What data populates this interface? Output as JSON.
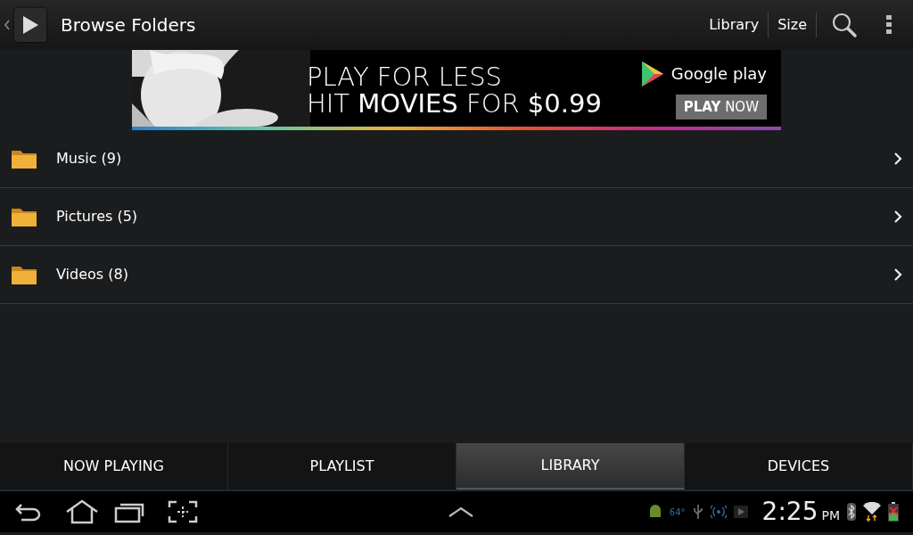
{
  "action_bar": {
    "title": "Browse Folders",
    "actions": [
      "Library",
      "Size"
    ]
  },
  "ad": {
    "line_1": "PLAY FOR LESS",
    "line_2": "HIT **MOVIES** FOR **$0.99**",
    "brand": "Google play",
    "button": "**PLAY** NOW"
  },
  "folders": [
    {
      "label": "Music (9)"
    },
    {
      "label": "Pictures (5)"
    },
    {
      "label": "Videos (8)"
    }
  ],
  "tabs": [
    {
      "label": "NOW PLAYING",
      "selected": false
    },
    {
      "label": "PLAYLIST",
      "selected": false
    },
    {
      "label": "LIBRARY",
      "selected": true
    },
    {
      "label": "DEVICES",
      "selected": false
    }
  ],
  "status_bar": {
    "temperature": "64°",
    "time": "2:25",
    "meridiem": "PM"
  }
}
